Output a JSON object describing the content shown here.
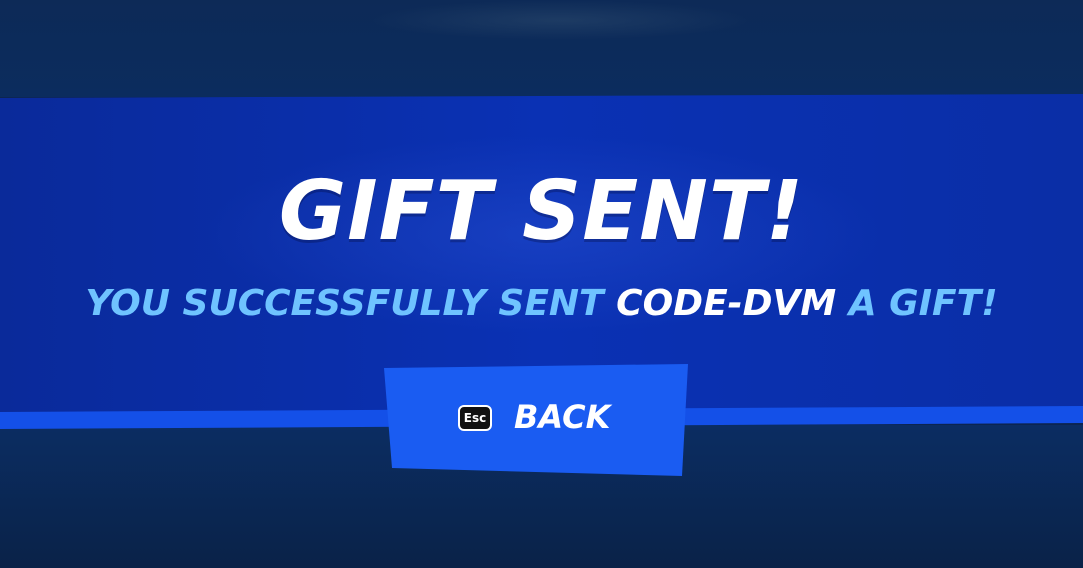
{
  "dialog": {
    "title": "GIFT SENT!",
    "message": {
      "before": "YOU SUCCESSFULLY SENT ",
      "recipient": "CODE-DVM",
      "after": " A GIFT!"
    },
    "back_button": {
      "key_hint": "Esc",
      "label": "BACK"
    }
  },
  "colors": {
    "background": "#0c2550",
    "banner": "#0a31b4",
    "stripe": "#1450e8",
    "button": "#1a5cf2",
    "message_text": "#6fc3ff",
    "title_text": "#ffffff"
  }
}
